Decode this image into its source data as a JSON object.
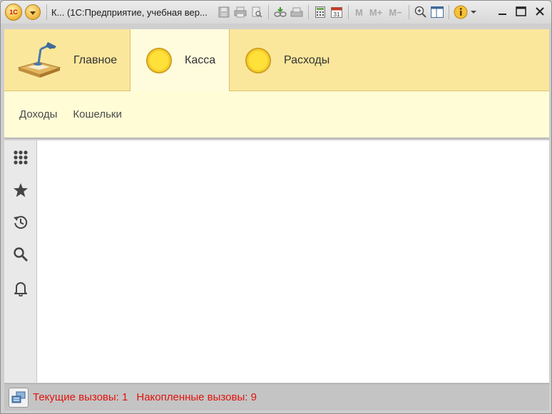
{
  "titlebar": {
    "logo_text": "1С",
    "title": "К... (1С:Предприятие, учебная вер...",
    "m_buttons": [
      "M",
      "M+",
      "M−"
    ]
  },
  "sections": [
    {
      "label": "Главное",
      "icon": "desk-lamp-icon",
      "active": false
    },
    {
      "label": "Касса",
      "icon": "coin-icon",
      "active": true
    },
    {
      "label": "Расходы",
      "icon": "coin-icon",
      "active": false
    }
  ],
  "subpanel": {
    "links": [
      "Доходы",
      "Кошельки"
    ]
  },
  "left_tools": [
    "apps-grid-icon",
    "star-icon",
    "history-icon",
    "search-icon",
    "bell-icon"
  ],
  "statusbar": {
    "current_calls": "Текущие вызовы: 1",
    "accumulated_calls": "Накопленные вызовы: 9"
  },
  "colors": {
    "section_bg": "#fbe79c",
    "active_section_bg": "#fffbdd",
    "subpanel_bg": "#fffcd6",
    "status_text": "#e0140e"
  }
}
